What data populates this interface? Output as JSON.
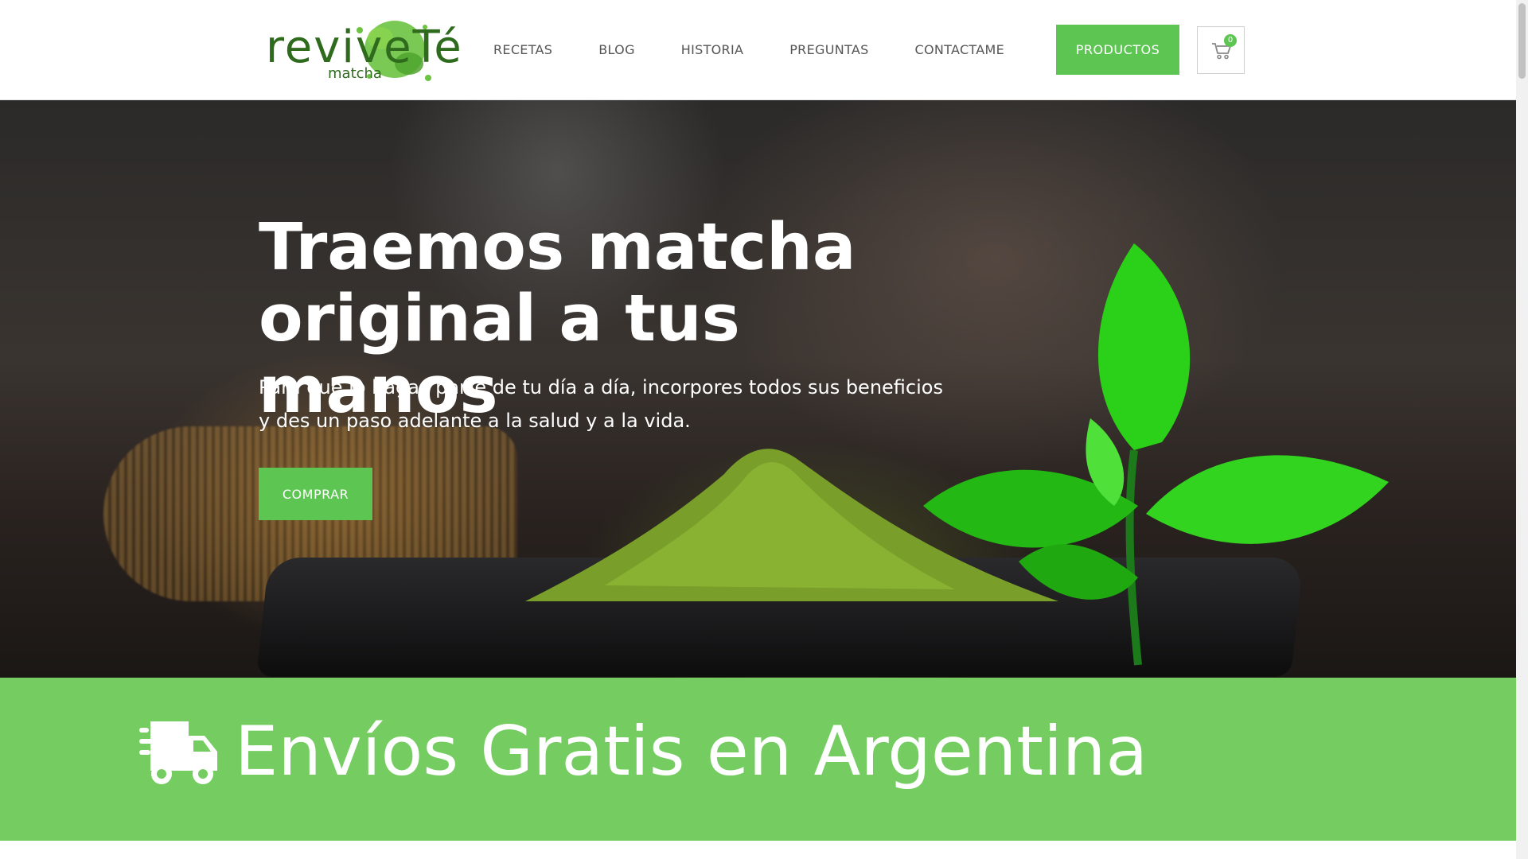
{
  "header": {
    "logo": {
      "brand": "reviveTé",
      "sub": "matcha"
    },
    "nav": [
      {
        "label": "RECETAS"
      },
      {
        "label": "BLOG"
      },
      {
        "label": "HISTORIA"
      },
      {
        "label": "PREGUNTAS"
      },
      {
        "label": "CONTACTAME"
      }
    ],
    "cta_label": "PRODUCTOS",
    "cart": {
      "icon": "cart-icon",
      "count": "0"
    }
  },
  "hero": {
    "title_line1": "Traemos matcha",
    "title_line2": "original a tus manos",
    "subtitle_line1": "Para que lo hagas parte de tu día a día, incorpores todos sus beneficios",
    "subtitle_line2": "y des un paso adelante a la salud y a la vida.",
    "button_label": "COMPRAR"
  },
  "shipping": {
    "icon": "truck-icon",
    "text": "Envíos Gratis en Argentina"
  },
  "colors": {
    "accent": "#5dc653",
    "banner": "#75cd62",
    "logo": "#2f6b1d",
    "nav_text": "#555555"
  }
}
